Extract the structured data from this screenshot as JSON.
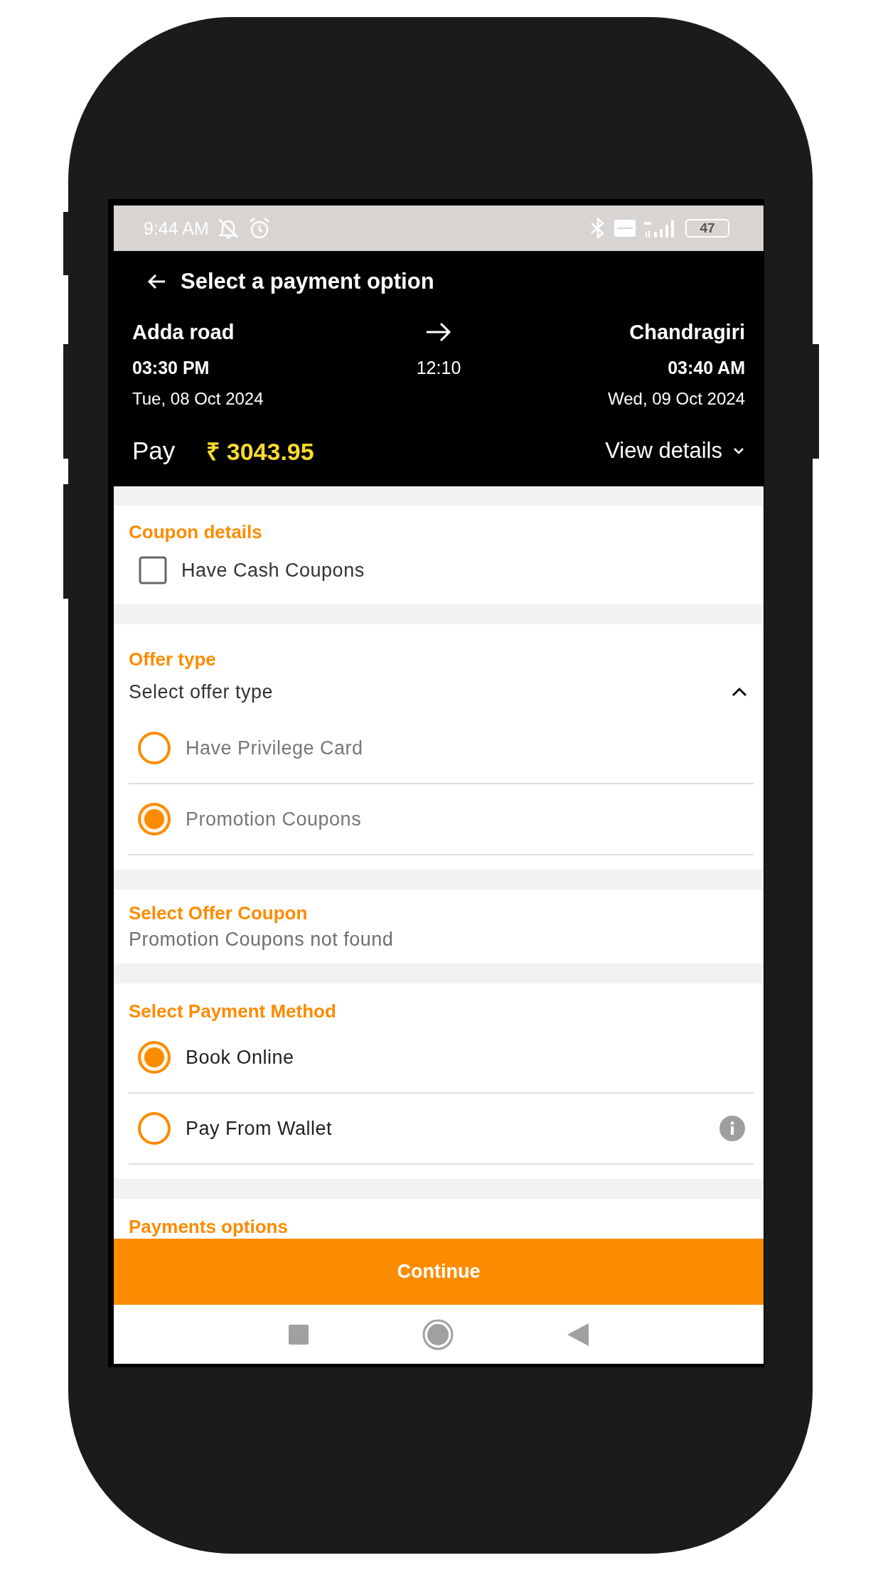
{
  "status_bar": {
    "time": "9:44 AM",
    "battery": "47"
  },
  "header": {
    "title": "Select a payment option"
  },
  "journey": {
    "from": {
      "place": "Adda road",
      "time": "03:30 PM",
      "date": "Tue, 08 Oct 2024"
    },
    "duration": "12:10",
    "to": {
      "place": "Chandragiri",
      "time": "03:40 AM",
      "date": "Wed, 09 Oct 2024"
    }
  },
  "fare": {
    "label": "Pay",
    "amount": "₹ 3043.95",
    "details_link": "View details"
  },
  "coupon": {
    "title": "Coupon details",
    "checkbox": {
      "label": "Have Cash Coupons",
      "checked": false
    }
  },
  "offer": {
    "title": "Offer type",
    "dropdown": {
      "label": "Select offer type",
      "expanded": true
    },
    "options": [
      {
        "label": "Have Privilege Card",
        "selected": false
      },
      {
        "label": "Promotion Coupons",
        "selected": true
      }
    ]
  },
  "offer_coupon": {
    "title": "Select Offer Coupon",
    "message": "Promotion Coupons not found"
  },
  "payment_method": {
    "title": "Select Payment Method",
    "options": [
      {
        "label": "Book Online",
        "selected": true,
        "info": false
      },
      {
        "label": "Pay From Wallet",
        "selected": false,
        "info": true
      }
    ]
  },
  "payments_options": {
    "title": "Payments options"
  },
  "continue_button": "Continue"
}
